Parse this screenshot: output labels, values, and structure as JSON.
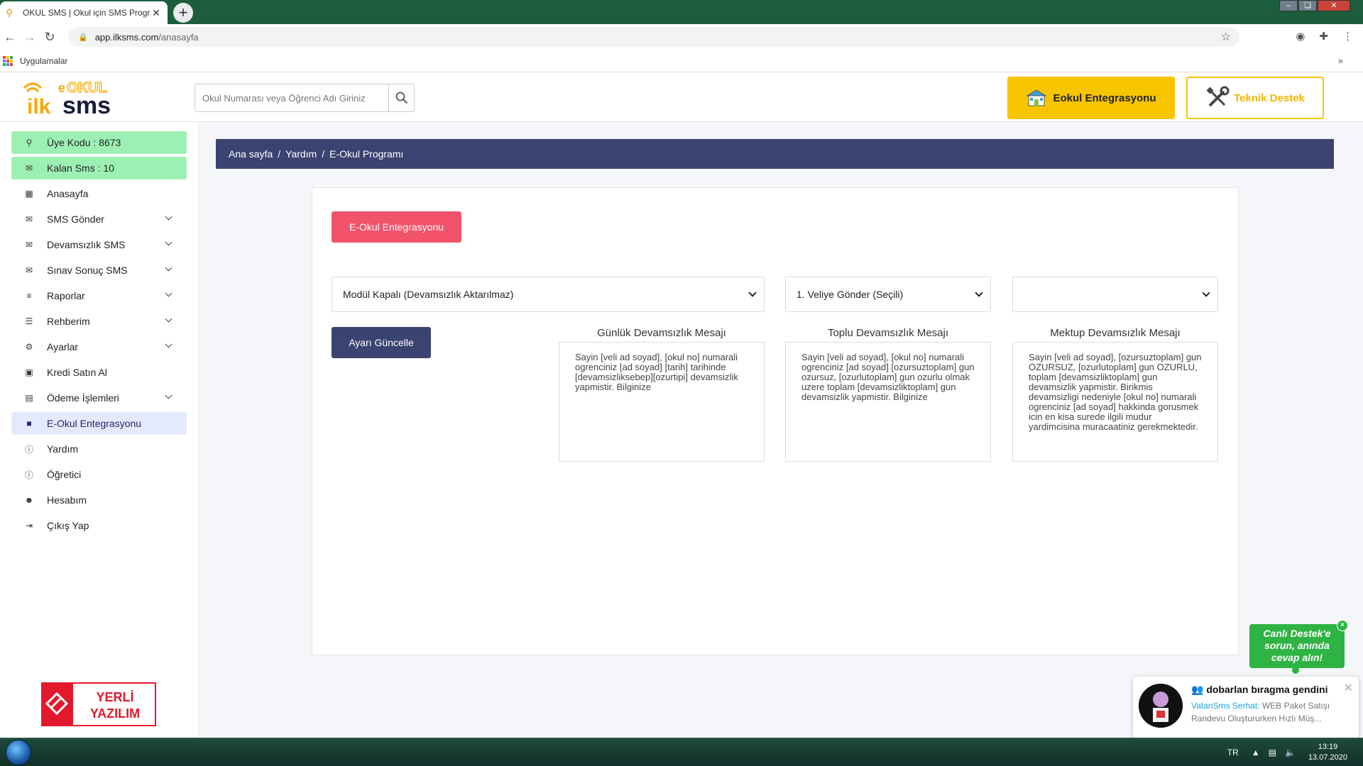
{
  "browser": {
    "tab_title": "OKUL SMS | Okul için SMS Progr",
    "url_host": "app.ilksms.com",
    "url_path": "/anasayfa",
    "bookmarks_label": "Uygulamalar"
  },
  "header": {
    "logo_text": "eOKUL ilksms",
    "search_placeholder": "Okul Numarası veya Öğrenci Adı Giriniz",
    "eokul_button": "Eokul Entegrasyonu",
    "support_button": "Teknik Destek"
  },
  "sidebar": {
    "items": [
      {
        "label": "Üye Kodu : 8673",
        "icon": "key-icon"
      },
      {
        "label": "Kalan Sms : 10",
        "icon": "envelope-icon"
      },
      {
        "label": "Anasayfa",
        "icon": "grid-icon"
      },
      {
        "label": "SMS Gönder",
        "icon": "envelope-icon"
      },
      {
        "label": "Devamsızlık SMS",
        "icon": "envelope-icon"
      },
      {
        "label": "Sınav Sonuç SMS",
        "icon": "envelope-icon"
      },
      {
        "label": "Raporlar",
        "icon": "list-icon"
      },
      {
        "label": "Rehberim",
        "icon": "list-icon"
      },
      {
        "label": "Ayarlar",
        "icon": "gear-icon"
      },
      {
        "label": "Kredi Satın Al",
        "icon": "money-icon"
      },
      {
        "label": "Ödeme İşlemleri",
        "icon": "wallet-icon"
      },
      {
        "label": "E-Okul Entegrasyonu",
        "icon": "folder-icon"
      },
      {
        "label": "Yardım",
        "icon": "question-icon"
      },
      {
        "label": "Öğretici",
        "icon": "info-icon"
      },
      {
        "label": "Hesabım",
        "icon": "user-icon"
      },
      {
        "label": "Çıkış Yap",
        "icon": "logout-icon"
      }
    ],
    "badge_line1": "YERLİ",
    "badge_line2": "YAZILIM"
  },
  "breadcrumb": {
    "home": "Ana sayfa",
    "sep": "/",
    "help": "Yardım",
    "current": "E-Okul Programı"
  },
  "main": {
    "integration_button": "E-Okul Entegrasyonu",
    "select_module": "Modül Kapalı (Devamsızlık Aktarılmaz)",
    "select_recipient": "1. Veliye Gönder (Seçili)",
    "select_third": "",
    "update_button": "Ayarı Güncelle",
    "daily_title": "Günlük Devamsızlık Mesajı",
    "daily_text": "Sayin [veli ad soyad], [okul no] numarali ogrenciniz [ad soyad] [tarih] tarihinde [devamsizliksebep][ozurtipi] devamsizlik yapmistir. Bilginize",
    "bulk_title": "Toplu Devamsızlık Mesajı",
    "bulk_text": "Sayin [veli ad soyad], [okul no] numarali ogrenciniz [ad soyad] [ozursuztoplam] gun ozursuz, [ozurlutoplam] gun ozurlu olmak uzere toplam [devamsizliktoplam] gun devamsizlik yapmistir. Bilginize",
    "letter_title": "Mektup Devamsızlık Mesajı",
    "letter_text": "Sayin [veli ad soyad], [ozursuztoplam] gun OZURSUZ, [ozurlutoplam] gun OZURLU, toplam [devamsizliktoplam] gun devamsizlik yapmistir. Birikmis devamsizligi nedeniyle [okul no] numarali ogrenciniz [ad soyad] hakkinda gorusmek icin en kisa surede ilgili mudur yardimcisina muracaatiniz gerekmektedir."
  },
  "live_support": {
    "text": "Canlı Destek'e sorun, anında cevap alın!",
    "close": "×"
  },
  "notification": {
    "title": "dobarlan bıragma gendini",
    "sender": "VatanSms Serhat:",
    "message": "WEB Paket Satışı Randevu Oluştururken Hızlı Müş..."
  },
  "taskbar": {
    "lang": "TR",
    "time": "13:19",
    "date": "13.07.2020"
  },
  "colors": {
    "navy": "#3b4371",
    "yellow": "#f7c500",
    "red_button": "#f3536a",
    "green_highlight": "#9cf0b4",
    "chat_green": "#2fb344"
  }
}
